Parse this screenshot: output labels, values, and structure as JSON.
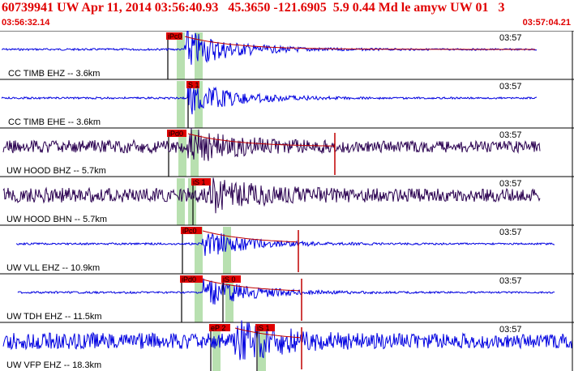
{
  "header": {
    "title": "60739941 UW Apr 11, 2014 03:56:40.93   45.3650 -121.6905  5.9 0.44 Md le amyw UW 01   3",
    "start_time": "03:56:32.14",
    "end_time": "03:57:04.21"
  },
  "colors": {
    "title": "#e00000",
    "trace_blue": "#0000e0",
    "trace_dark": "#2a0050",
    "pick_bar": "#b8e0b0",
    "pick_label_bg": "#e00000",
    "envelope": "#c00000"
  },
  "traces": [
    {
      "label": "CC TIMB EHZ -- 3.6km",
      "time_label": "03:57",
      "pick": "iPc0",
      "color": "blue"
    },
    {
      "label": "CC TIMB EHE -- 3.6km",
      "time_label": "03:57",
      "pick": "S 1",
      "color": "blue"
    },
    {
      "label": "UW HOOD BHZ -- 5.7km",
      "time_label": "03:57",
      "pick": "iPd0",
      "color": "dark"
    },
    {
      "label": "UW HOOD BHN -- 5.7km",
      "time_label": "03:57",
      "pick": "iS 1",
      "color": "dark"
    },
    {
      "label": "UW VLL EHZ -- 10.9km",
      "time_label": "03:57",
      "pick": "iPc0",
      "color": "blue"
    },
    {
      "label": "UW TDH EHZ -- 11.5km",
      "time_label": "03:57",
      "pick": "iPd0",
      "pick2": "iS 0",
      "color": "blue"
    },
    {
      "label": "UW VFP EHZ -- 18.3km",
      "time_label": "03:57",
      "pick": "eP 2",
      "pick2": "iS 1",
      "color": "blue"
    }
  ]
}
